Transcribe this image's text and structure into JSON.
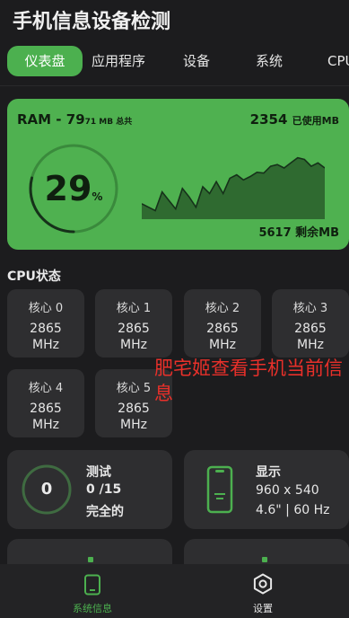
{
  "app": {
    "title": "手机信息设备检测"
  },
  "tabs": [
    {
      "label": "仪表盘",
      "active": true
    },
    {
      "label": "应用程序",
      "active": false
    },
    {
      "label": "设备",
      "active": false
    },
    {
      "label": "系统",
      "active": false
    },
    {
      "label": "CPU",
      "active": false
    }
  ],
  "ram": {
    "title": "RAM - 79",
    "total": "71 MB 总共",
    "used_value": "2354",
    "used_label": "已使用MB",
    "free": "5617 剩余MB",
    "percent": "29",
    "percent_unit": "%",
    "usage_fraction": 0.29,
    "history": [
      18,
      14,
      10,
      32,
      22,
      12,
      36,
      26,
      14,
      38,
      30,
      44,
      30,
      48,
      52,
      46,
      50,
      55,
      54,
      62,
      64,
      60,
      66,
      72,
      70,
      62,
      66,
      60
    ],
    "colors": {
      "card": "#4fb150",
      "chart_fill": "#2f6a30",
      "chart_line": "#16311a"
    }
  },
  "cpu": {
    "section_title": "CPU状态",
    "cores": [
      {
        "name": "核心 0",
        "freq": "2865",
        "unit": "MHz"
      },
      {
        "name": "核心 1",
        "freq": "2865",
        "unit": "MHz"
      },
      {
        "name": "核心 2",
        "freq": "2865",
        "unit": "MHz"
      },
      {
        "name": "核心 3",
        "freq": "2865",
        "unit": "MHz"
      },
      {
        "name": "核心 4",
        "freq": "2865",
        "unit": "MHz"
      },
      {
        "name": "核心 5",
        "freq": "2865",
        "unit": "MHz"
      }
    ]
  },
  "overlay": {
    "text": "肥宅姬查看手机当前信息",
    "color": "#e8302a"
  },
  "test_card": {
    "count": "0",
    "title": "测试",
    "progress": "0 /15",
    "status": "完全的",
    "fraction": 0
  },
  "display_card": {
    "title": "显示",
    "resolution": "960 x 540",
    "spec": "4.6\" | 60 Hz",
    "icon": "phone-icon"
  },
  "bottom_nav": [
    {
      "label": "系统信息",
      "icon": "phone-icon",
      "active": true,
      "color": "#4cb04f"
    },
    {
      "label": "设置",
      "icon": "gear-icon",
      "active": false,
      "color": "#e6e6e6"
    }
  ]
}
